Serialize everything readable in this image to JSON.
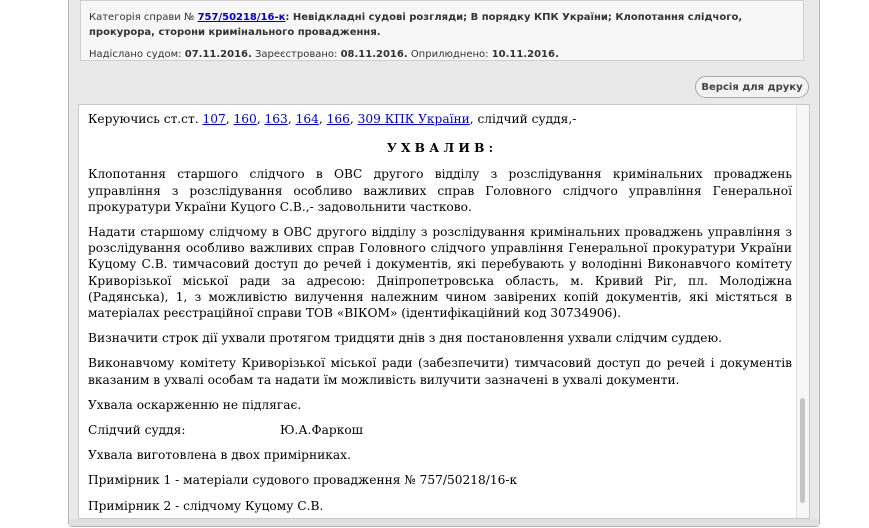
{
  "info": {
    "category_label": "Категорія справи №",
    "case_number": "757/50218/16-к",
    "category_text": ": Невідкладні судові розгляди; В порядку КПК України; Клопотання слідчого, прокурора, сторони кримінального провадження.",
    "sent_label": "Надіслано судом:",
    "sent_date": "07.11.2016.",
    "registered_label": "Зареєстровано:",
    "registered_date": "08.11.2016.",
    "published_label": "Оприлюднено:",
    "published_date": "10.11.2016."
  },
  "print_button": "Версія для друку",
  "document": {
    "intro_prefix": "Керуючись ст.ст. ",
    "articles": [
      "107",
      "160",
      "163",
      "164",
      "166",
      "309 КПК України"
    ],
    "intro_suffix": ", слідчий суддя,-",
    "heading": "У Х В А Л И В :",
    "p1": "Клопотання старшого слідчого в ОВС другого відділу з розслідування кримінальних проваджень управління з розслідування особливо важливих справ Головного слідчого управління Генеральної прокуратури України Куцого С.В.,- задовольнити частково.",
    "p2": "Надати старшому слідчому в ОВС другого відділу з розслідування кримінальних проваджень управління з розслідування особливо важливих справ Головного слідчого управління Генеральної прокуратури України Куцому С.В. тимчасовий доступ до речей і документів, які перебувають у володінні Виконавчого комітету Криворізької міської ради за адресою: Дніпропетровська область, м. Кривий Ріг, пл. Молодіжна (Радянська), 1, з можливістю вилучення належним чином завірених копій документів, які містяться в матеріалах реєстраційної справи ТОВ «ВІКОМ» (ідентифікаційний код 30734906).",
    "p3": "Визначити строк дії ухвали протягом тридцяти днів з дня постановлення ухвали слідчим суддею.",
    "p4": "Виконавчому комітету Криворізької міської ради (забезпечити) тимчасовий доступ до речей і документів вказаним в ухвалі особам та надати їм можливість вилучити зазначені в ухвалі документи.",
    "p5": "Ухвала оскарженню не підлягає.",
    "judge_label": "Слідчий суддя:",
    "judge_name": "Ю.А.Фаркош",
    "p6": "Ухвала виготовлена в двох примірниках.",
    "p7": "Примірник 1 - матеріали судового провадження № 757/50218/16-к",
    "p8": "Примірник 2 - слідчому Куцому С.В."
  }
}
